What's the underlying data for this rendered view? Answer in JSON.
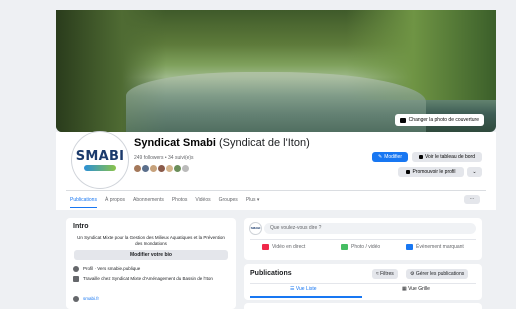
{
  "cover": {
    "change_button": "Changer la photo de couverture"
  },
  "page": {
    "logo_text": "SMABI",
    "name": "Syndicat Smabi",
    "alt_name": "(Syndicat de l'Iton)",
    "followers": "249 followers • 34 suivi(e)s",
    "follower_faces": [
      "#a4785a",
      "#5b6f8c",
      "#c7a27c",
      "#8a5a4a",
      "#d4b48c",
      "#6b8e5a",
      "#bbbbbb"
    ]
  },
  "actions": {
    "edit": "Modifier",
    "dashboard": "Voir le tableau de bord",
    "promote": "Promouvoir le profil",
    "more": "⌄"
  },
  "tabs": [
    "Publications",
    "À propos",
    "Abonnements",
    "Photos",
    "Vidéos",
    "Groupes",
    "Plus ▾"
  ],
  "tabs_more": "···",
  "intro": {
    "title": "Intro",
    "bio": "Un Syndicat Mixte pour la Gestion des Milieux Aquatiques et la Prévention des Inondations",
    "edit_bio": "Modifier votre bio",
    "rows": [
      {
        "icon": "info-icon",
        "text": "Profil · Vers smabie.publique"
      },
      {
        "icon": "briefcase-icon",
        "text": "Travaille chez Syndicat Mixte d'Aménagement du Bassin de l'Iton"
      },
      {
        "icon": "link-icon",
        "text": "smabi.fr"
      }
    ]
  },
  "composer": {
    "placeholder": "Que voulez-vous dire ?",
    "live": "Vidéo en direct",
    "photo": "Photo / vidéo",
    "event": "Évènement marquant"
  },
  "publications": {
    "title": "Publications",
    "filters": "≈ Filtres",
    "manage": "⚙ Gérer les publications",
    "list_view": "☰ Vue Liste",
    "grid_view": "▦ Vue Grille"
  },
  "colors": {
    "accent": "#1877f2",
    "live": "#f02849",
    "photo": "#45bd62",
    "event": "#1877f2"
  }
}
